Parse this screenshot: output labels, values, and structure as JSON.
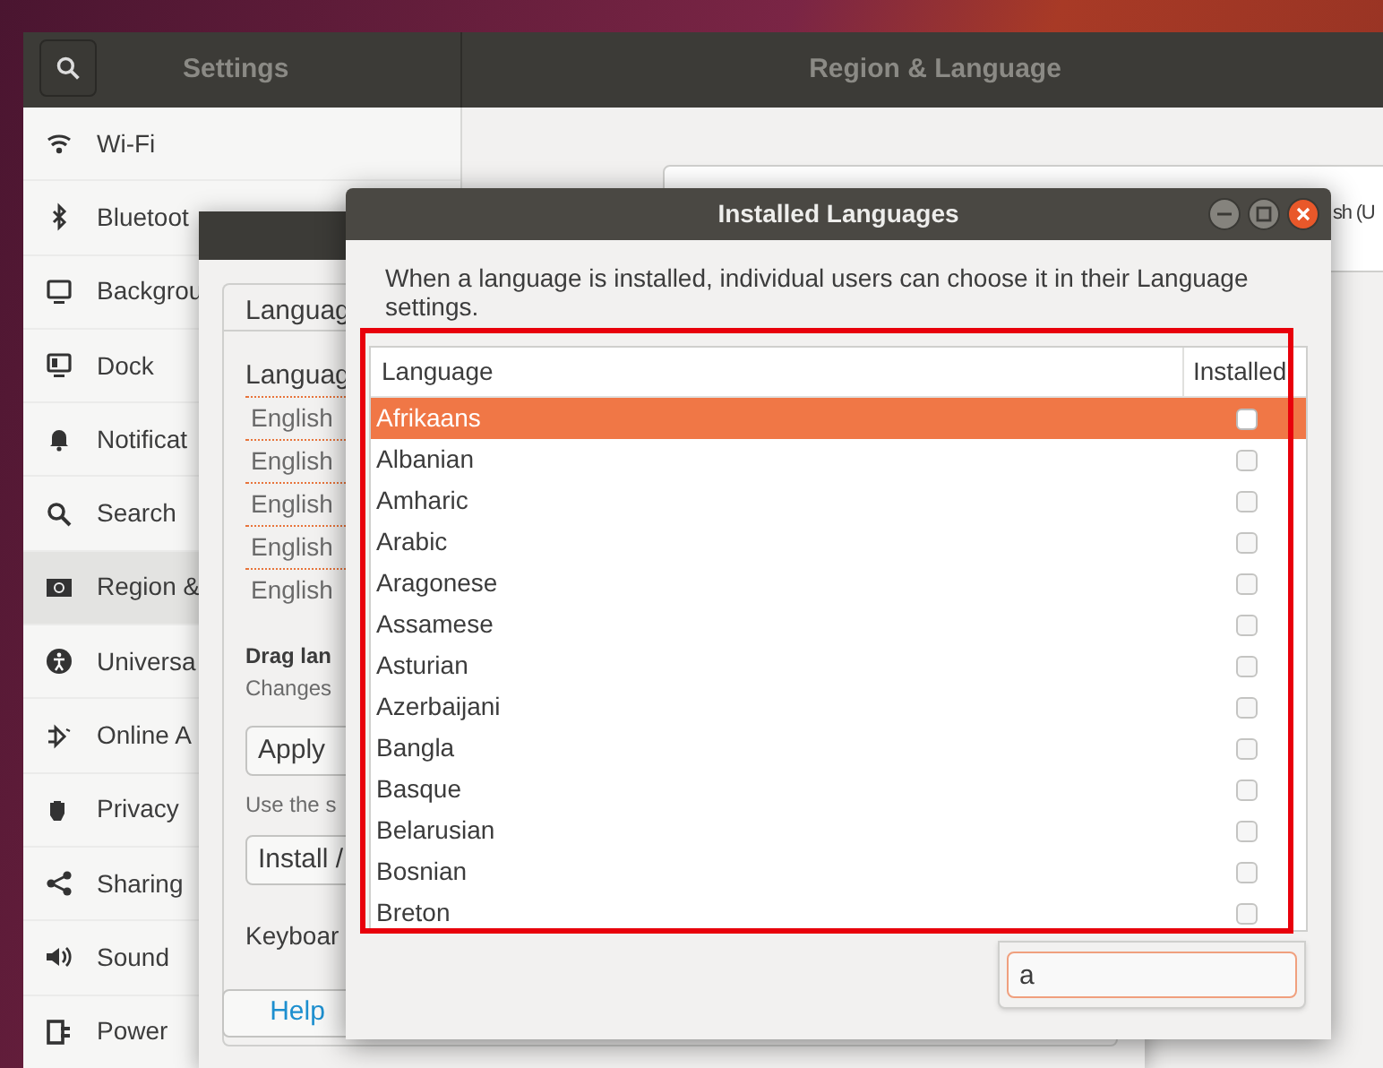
{
  "settings_window": {
    "title": "Settings",
    "panel_title": "Region & Language",
    "sidebar": {
      "items": [
        {
          "label": "Wi-Fi",
          "selected": false
        },
        {
          "label": "Bluetoot",
          "selected": false
        },
        {
          "label": "Backgrou",
          "selected": false
        },
        {
          "label": "Dock",
          "selected": false
        },
        {
          "label": "Notificat",
          "selected": false
        },
        {
          "label": "Search",
          "selected": false
        },
        {
          "label": "Region &",
          "selected": true
        },
        {
          "label": "Universa",
          "selected": false
        },
        {
          "label": "Online A",
          "selected": false
        },
        {
          "label": "Privacy",
          "selected": false
        },
        {
          "label": "Sharing",
          "selected": false
        },
        {
          "label": "Sound",
          "selected": false
        },
        {
          "label": "Power",
          "selected": false
        }
      ]
    },
    "content_fragment": "sh (U"
  },
  "language_support_window": {
    "tab": "Languag",
    "heading": "Languag",
    "languages": [
      "English",
      "English",
      "English",
      "English",
      "English"
    ],
    "hint_bold": "Drag lan",
    "hint": "Changes",
    "apply_button": "Apply",
    "use_text": "Use the s",
    "install_button": "Install /",
    "keyboard_label": "Keyboar",
    "help_button": "Help"
  },
  "installed_languages_dialog": {
    "title": "Installed Languages",
    "description": "When a language is installed, individual users can choose it in their Language settings.",
    "table": {
      "columns": [
        "Language",
        "Installed"
      ],
      "rows": [
        {
          "language": "Afrikaans",
          "checked": false,
          "selected": true
        },
        {
          "language": "Albanian",
          "checked": false,
          "selected": false
        },
        {
          "language": "Amharic",
          "checked": false,
          "selected": false
        },
        {
          "language": "Arabic",
          "checked": false,
          "selected": false
        },
        {
          "language": "Aragonese",
          "checked": false,
          "selected": false
        },
        {
          "language": "Assamese",
          "checked": false,
          "selected": false
        },
        {
          "language": "Asturian",
          "checked": false,
          "selected": false
        },
        {
          "language": "Azerbaijani",
          "checked": false,
          "selected": false
        },
        {
          "language": "Bangla",
          "checked": false,
          "selected": false
        },
        {
          "language": "Basque",
          "checked": false,
          "selected": false
        },
        {
          "language": "Belarusian",
          "checked": false,
          "selected": false
        },
        {
          "language": "Bosnian",
          "checked": false,
          "selected": false
        },
        {
          "language": "Breton",
          "checked": false,
          "selected": false
        }
      ]
    },
    "search": {
      "value": "a"
    }
  }
}
